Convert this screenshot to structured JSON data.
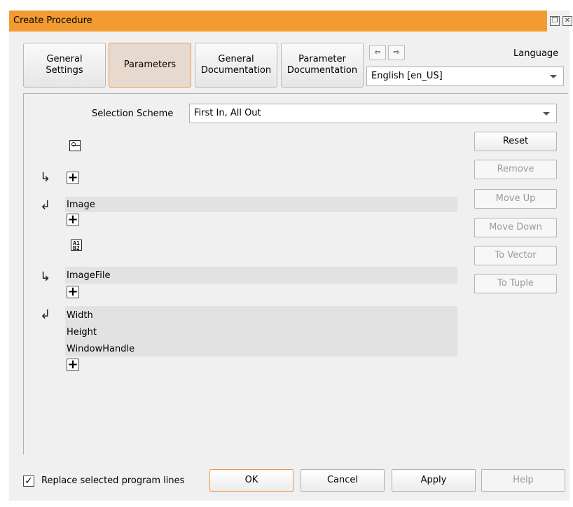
{
  "window": {
    "title": "Create Procedure",
    "restore_icon": "restore-icon",
    "close_icon": "close-icon"
  },
  "tabs": [
    {
      "label": "General\nSettings",
      "active": false
    },
    {
      "label": "Parameters",
      "active": true
    },
    {
      "label": "General\nDocumentation",
      "active": false
    },
    {
      "label": "Parameter\nDocumentation",
      "active": false
    }
  ],
  "nav": {
    "prev_icon": "arrow-left-icon",
    "next_icon": "arrow-right-icon"
  },
  "language": {
    "label": "Language",
    "selected": "English [en_US]"
  },
  "selection_scheme": {
    "label": "Selection Scheme",
    "selected": "First In, All Out"
  },
  "iconic_params": {
    "type_icon": "image-icon",
    "inputs": [],
    "outputs": [
      "Image"
    ]
  },
  "control_params": {
    "type_icon": "control-icon",
    "type_icon_text": "A1\nB2",
    "inputs": [
      "ImageFile"
    ],
    "outputs": [
      "Width",
      "Height",
      "WindowHandle"
    ]
  },
  "side_buttons": [
    {
      "label": "Reset",
      "enabled": true
    },
    {
      "label": "Remove",
      "enabled": false
    },
    {
      "label": "Move Up",
      "enabled": false
    },
    {
      "label": "Move Down",
      "enabled": false
    },
    {
      "label": "To Vector",
      "enabled": false
    },
    {
      "label": "To Tuple",
      "enabled": false
    }
  ],
  "footer": {
    "replace_checked": true,
    "replace_label": "Replace selected program lines",
    "ok": "OK",
    "cancel": "Cancel",
    "apply": "Apply",
    "help": "Help"
  }
}
